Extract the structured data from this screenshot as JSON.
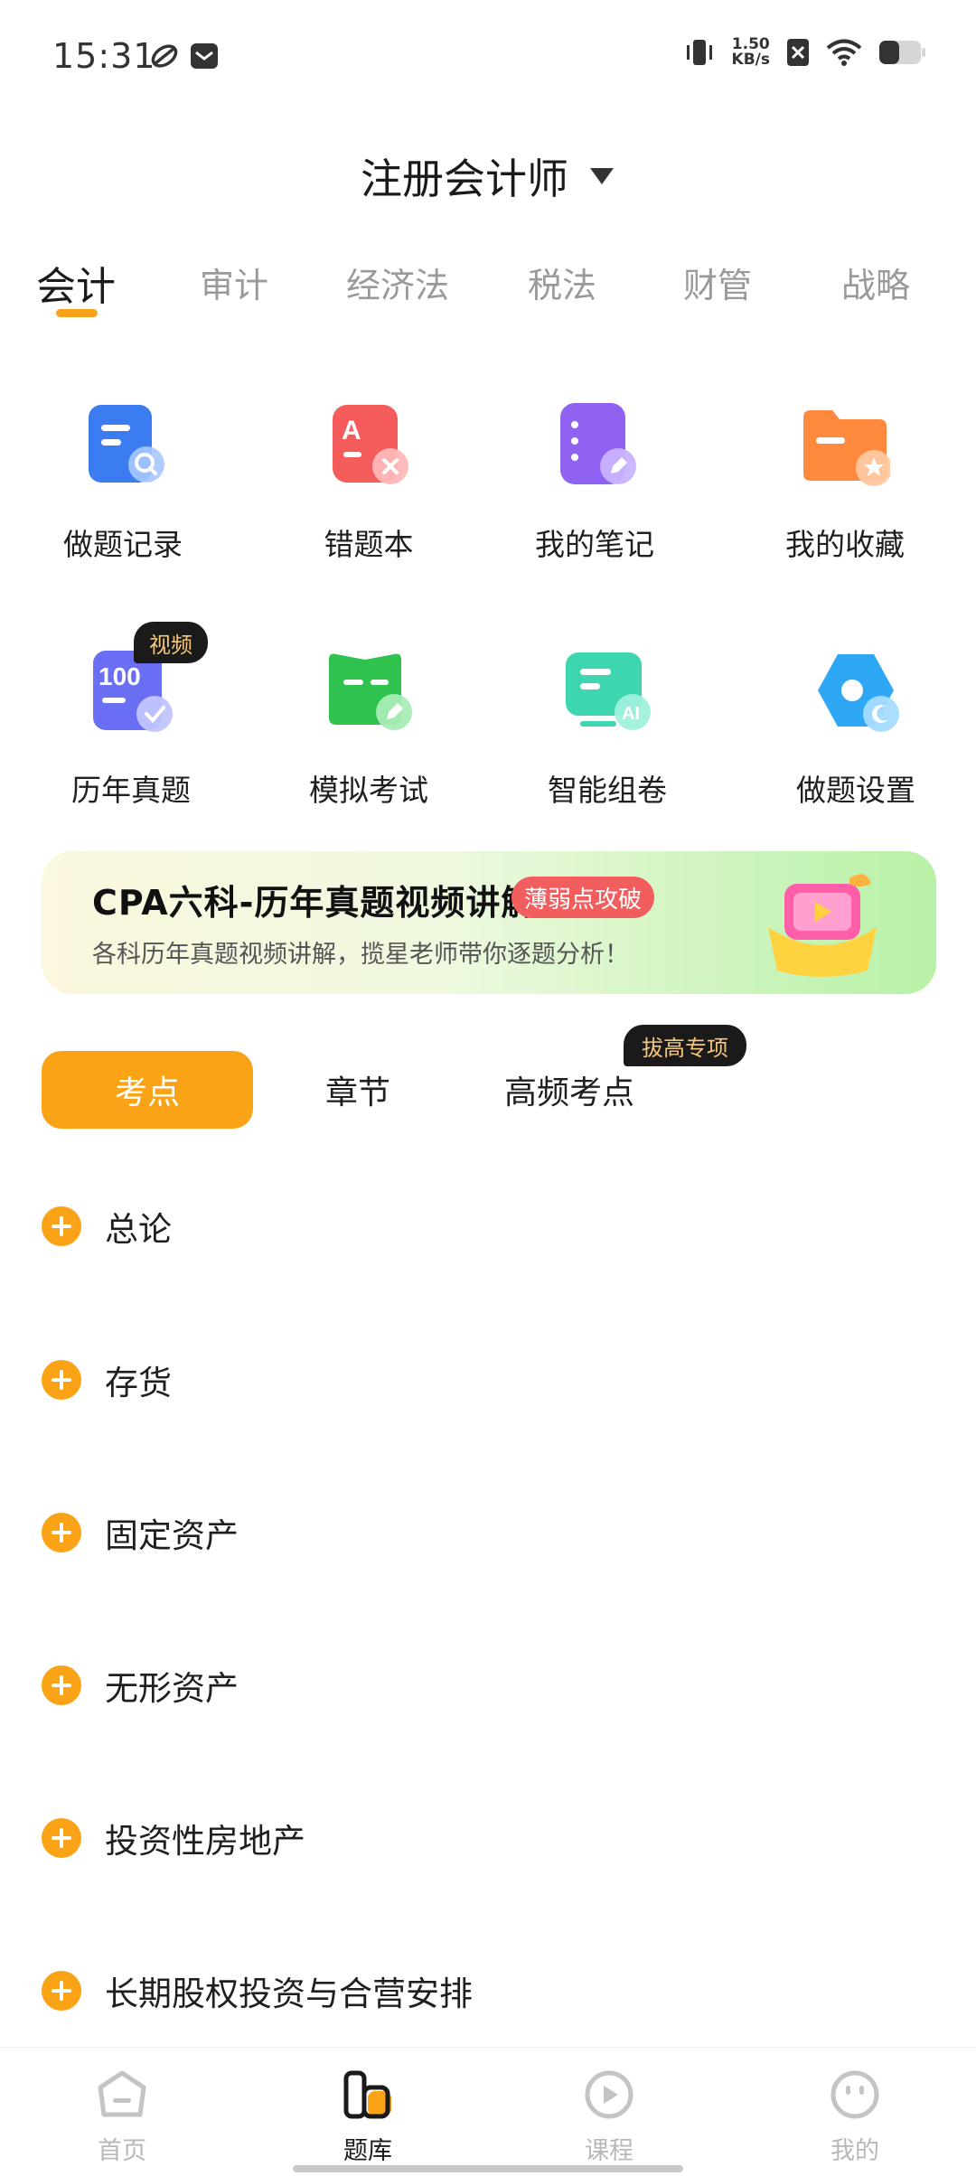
{
  "status_bar": {
    "time": "15:31",
    "net_speed_value": "1.50",
    "net_speed_unit": "KB/s",
    "icons": [
      "pinwheel-icon",
      "mail-icon",
      "vibrate-icon",
      "sim-off-icon",
      "wifi-icon",
      "battery-icon"
    ]
  },
  "header": {
    "title": "注册会计师",
    "dropdown_icon": "triangle-down-icon"
  },
  "subject_tabs": [
    "会计",
    "审计",
    "经济法",
    "税法",
    "财管",
    "战略"
  ],
  "features": [
    {
      "label": "做题记录",
      "icon": "record-search-icon"
    },
    {
      "label": "错题本",
      "icon": "wrong-book-icon"
    },
    {
      "label": "我的笔记",
      "icon": "notes-icon"
    },
    {
      "label": "我的收藏",
      "icon": "favorite-folder-icon"
    },
    {
      "label": "历年真题",
      "icon": "past-exams-icon",
      "badge": "视频"
    },
    {
      "label": "模拟考试",
      "icon": "mock-exam-icon"
    },
    {
      "label": "智能组卷",
      "icon": "ai-paper-icon"
    },
    {
      "label": "做题设置",
      "icon": "settings-hex-icon"
    }
  ],
  "banner": {
    "title": "CPA六科-历年真题视频讲解",
    "tag": "薄弱点攻破",
    "subtitle": "各科历年真题视频讲解，揽星老师带你逐题分析！"
  },
  "segment_tabs": [
    {
      "label": "考点"
    },
    {
      "label": "章节"
    },
    {
      "label": "高频考点",
      "badge": "拔高专项"
    }
  ],
  "topics": [
    "总论",
    "存货",
    "固定资产",
    "无形资产",
    "投资性房地产",
    "长期股权投资与合营安排"
  ],
  "bottom_nav": [
    {
      "label": "首页",
      "icon": "home-icon"
    },
    {
      "label": "题库",
      "icon": "question-bank-icon",
      "active": true
    },
    {
      "label": "课程",
      "icon": "course-play-icon"
    },
    {
      "label": "我的",
      "icon": "profile-icon"
    }
  ],
  "colors": {
    "accent": "#fba317",
    "tag_red": "#f25d5d",
    "badge_dark": "#1a1a1a"
  }
}
